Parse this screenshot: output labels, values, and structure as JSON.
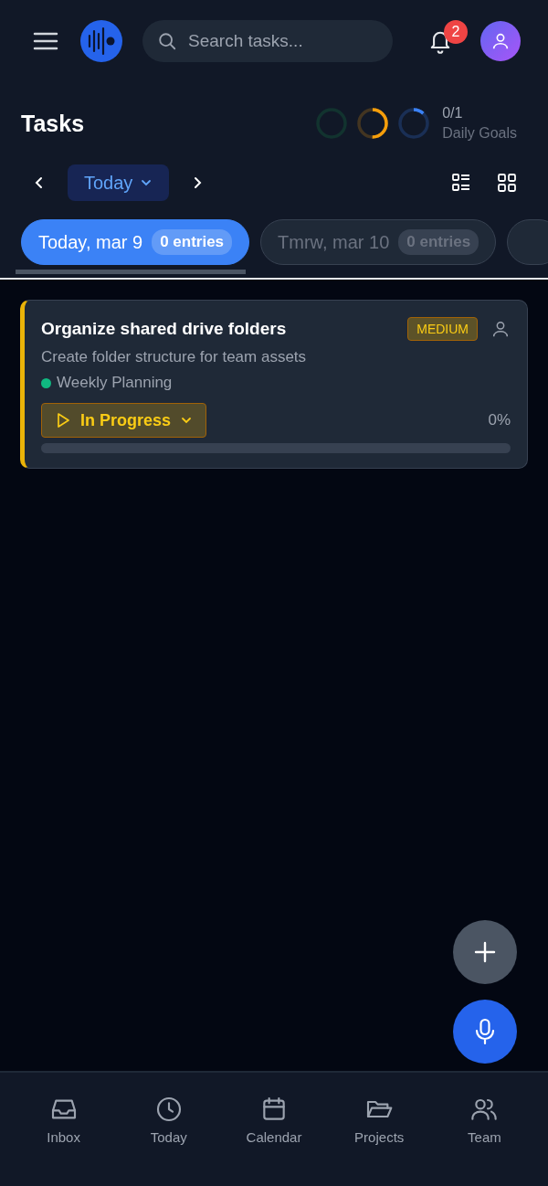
{
  "header": {
    "search": {
      "placeholder": "Search tasks..."
    },
    "notifications": "2"
  },
  "page": {
    "title": "Tasks",
    "goals": {
      "rings": [
        {
          "color": "#12332f"
        },
        {
          "color": "#f59e0b",
          "level": 0.5
        },
        {
          "color": "#3b82f6",
          "level": 0.12
        }
      ],
      "count": "0/1",
      "label": "Daily Goals"
    }
  },
  "date_nav": {
    "label": "Today"
  },
  "view_toggle": [
    {
      "kind": "list",
      "selected": false
    },
    {
      "kind": "grid",
      "selected": false
    }
  ],
  "day_tabs": [
    {
      "label": "Today, mar 9",
      "count": "0 entries",
      "selected": true
    },
    {
      "label": "Tmrw, mar 10",
      "count": "0 entries",
      "selected": false
    },
    {
      "selected": false
    }
  ],
  "tasks": [
    {
      "title": "Organize shared drive folders",
      "description": "Create folder structure for team assets",
      "priority": "MEDIUM",
      "color": "#eab308",
      "project": {
        "name": "Weekly Planning",
        "color": "#10b981"
      },
      "status": "In Progress",
      "level": 0,
      "percent": "0%"
    }
  ],
  "bottom_nav": [
    {
      "kind": "inbox",
      "label": "Inbox",
      "selected": false
    },
    {
      "kind": "clock",
      "label": "Today",
      "selected": false
    },
    {
      "kind": "calendar",
      "label": "Calendar",
      "selected": false
    },
    {
      "kind": "folder",
      "label": "Projects",
      "selected": false
    },
    {
      "kind": "team",
      "label": "Team",
      "selected": false
    }
  ]
}
